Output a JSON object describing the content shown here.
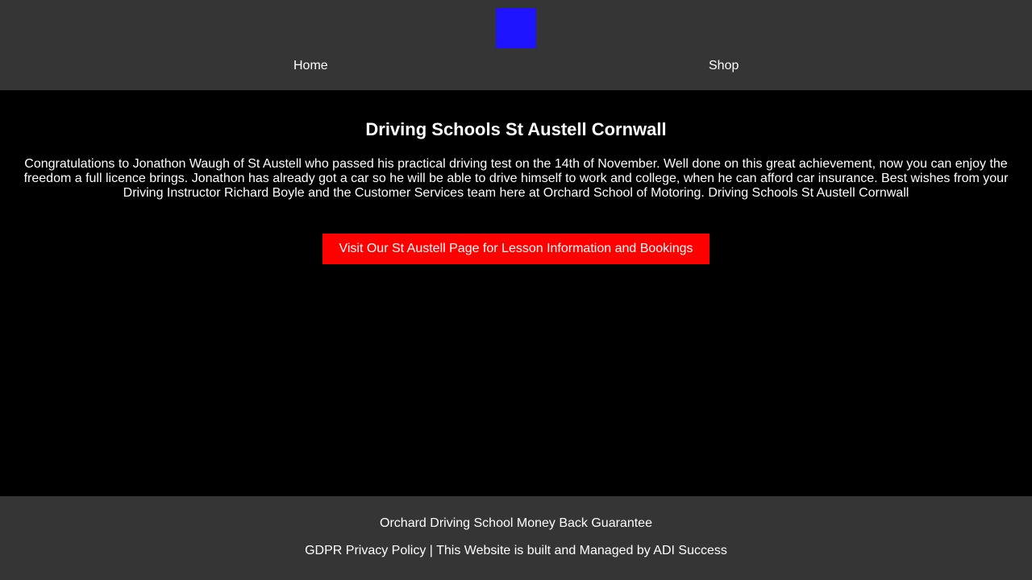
{
  "header": {
    "logo_color": "#1f14ff",
    "nav": {
      "home": "Home",
      "shop": "Shop"
    }
  },
  "main": {
    "title": "Driving Schools St Austell Cornwall",
    "body": "Congratulations to Jonathon Waugh of St Austell who passed his practical driving test on the 14th of November. Well done on this great achievement, now you can enjoy the freedom a full licence brings. Jonathon has already got a car so he will be able to drive himself to work and college, when he can afford car insurance. Best wishes from your Driving Instructor Richard Boyle and the Customer Services team here at Orchard School of Motoring. Driving Schools St Austell Cornwall",
    "cta_label": "Visit Our St Austell Page for Lesson Information and Bookings",
    "cta_color": "#ff0000"
  },
  "footer": {
    "guarantee": "Orchard Driving School Money Back Guarantee",
    "privacy": "GDPR Privacy Policy",
    "separator": " | ",
    "built_by": "This Website is built and Managed by ADI Success"
  },
  "colors": {
    "background": "#000000",
    "bar": "#353535",
    "text": "#ffffff"
  }
}
